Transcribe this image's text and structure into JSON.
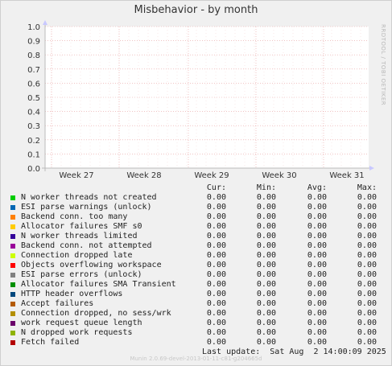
{
  "title": "Misbehavior - by month",
  "watermark": "RRDTOOL / TOBI OETIKER",
  "munin_version": "Munin 2.0.69-devel-2013-01-11-c81-g204665d",
  "last_update": "Last update:  Sat Aug  2 14:00:09 2025",
  "colors": {
    "grid": "#e8a0a0",
    "axis": "#bbbbbb",
    "line": "#000000"
  },
  "chart_data": {
    "type": "line",
    "ylim": [
      0.0,
      1.0
    ],
    "yticks": [
      "0.0",
      "0.1",
      "0.2",
      "0.3",
      "0.4",
      "0.5",
      "0.6",
      "0.7",
      "0.8",
      "0.9",
      "1.0"
    ],
    "xticks": [
      "Week 27",
      "Week 28",
      "Week 29",
      "Week 30",
      "Week 31"
    ],
    "grid": true
  },
  "legend": {
    "headers": [
      "Cur:",
      "Min:",
      "Avg:",
      "Max:"
    ],
    "rows": [
      {
        "label": "N worker threads not created",
        "color": "#00cc00",
        "values": [
          "0.00",
          "0.00",
          "0.00",
          "0.00"
        ]
      },
      {
        "label": "ESI parse warnings (unlock)",
        "color": "#0066b3",
        "values": [
          "0.00",
          "0.00",
          "0.00",
          "0.00"
        ]
      },
      {
        "label": "Backend conn. too many",
        "color": "#ff8000",
        "values": [
          "0.00",
          "0.00",
          "0.00",
          "0.00"
        ]
      },
      {
        "label": "Allocator failures SMF s0",
        "color": "#ffcc00",
        "values": [
          "0.00",
          "0.00",
          "0.00",
          "0.00"
        ]
      },
      {
        "label": "N worker threads limited",
        "color": "#330099",
        "values": [
          "0.00",
          "0.00",
          "0.00",
          "0.00"
        ]
      },
      {
        "label": "Backend conn. not attempted",
        "color": "#990099",
        "values": [
          "0.00",
          "0.00",
          "0.00",
          "0.00"
        ]
      },
      {
        "label": "Connection dropped late",
        "color": "#ccff00",
        "values": [
          "0.00",
          "0.00",
          "0.00",
          "0.00"
        ]
      },
      {
        "label": "Objects overflowing workspace",
        "color": "#ff0000",
        "values": [
          "0.00",
          "0.00",
          "0.00",
          "0.00"
        ]
      },
      {
        "label": "ESI parse errors (unlock)",
        "color": "#808080",
        "values": [
          "0.00",
          "0.00",
          "0.00",
          "0.00"
        ]
      },
      {
        "label": "Allocator failures SMA Transient",
        "color": "#008f00",
        "values": [
          "0.00",
          "0.00",
          "0.00",
          "0.00"
        ]
      },
      {
        "label": "HTTP header overflows",
        "color": "#00487d",
        "values": [
          "0.00",
          "0.00",
          "0.00",
          "0.00"
        ]
      },
      {
        "label": "Accept failures",
        "color": "#b35a00",
        "values": [
          "0.00",
          "0.00",
          "0.00",
          "0.00"
        ]
      },
      {
        "label": "Connection dropped, no sess/wrk",
        "color": "#b38f00",
        "values": [
          "0.00",
          "0.00",
          "0.00",
          "0.00"
        ]
      },
      {
        "label": "work request queue length",
        "color": "#6b006b",
        "values": [
          "0.00",
          "0.00",
          "0.00",
          "0.00"
        ]
      },
      {
        "label": "N dropped work requests",
        "color": "#8fb300",
        "values": [
          "0.00",
          "0.00",
          "0.00",
          "0.00"
        ]
      },
      {
        "label": "Fetch failed",
        "color": "#b30000",
        "values": [
          "0.00",
          "0.00",
          "0.00",
          "0.00"
        ]
      }
    ]
  }
}
